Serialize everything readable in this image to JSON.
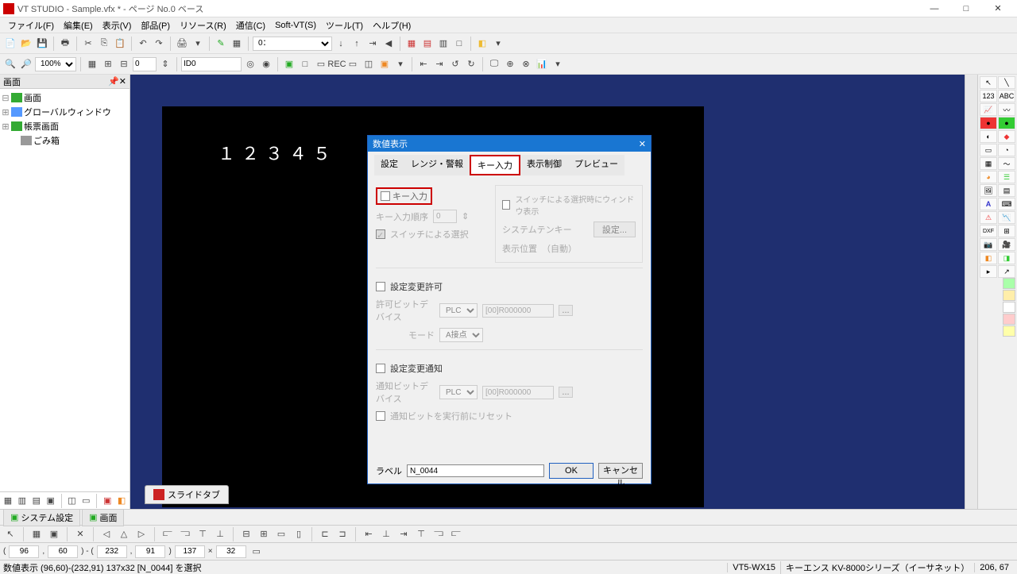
{
  "window": {
    "title": "VT STUDIO - Sample.vfx * - ページ No.0 ベース",
    "min": "—",
    "max": "□",
    "close": "✕"
  },
  "menu": {
    "file": "ファイル(F)",
    "edit": "編集(E)",
    "view": "表示(V)",
    "parts": "部品(P)",
    "resource": "リソース(R)",
    "comm": "通信(C)",
    "softvt": "Soft-VT(S)",
    "tool": "ツール(T)",
    "help": "ヘルプ(H)"
  },
  "toolbar1": {
    "zoom_combo": "0："
  },
  "toolbar2": {
    "zoom_pct": "100%",
    "num_field": "0",
    "id_field": "ID0"
  },
  "sidebar": {
    "header": "画面",
    "items": [
      {
        "exp": "⊟",
        "label": "画面"
      },
      {
        "exp": "⊞",
        "label": "グローバルウィンドウ"
      },
      {
        "exp": "⊞",
        "label": "帳票画面"
      },
      {
        "exp": "",
        "label": "ごみ箱"
      }
    ]
  },
  "bottomtabs": {
    "sys": "システム設定",
    "screen": "画面"
  },
  "canvas": {
    "num_display": "１２３４５",
    "slide_tab": "スライドタブ"
  },
  "coords": {
    "x1": "96",
    "y1": "60",
    "x2": "232",
    "y2": "91",
    "w": "137",
    "h": "32"
  },
  "status": {
    "left": "数値表示 (96,60)-(232,91) 137x32 [N_0044] を選択",
    "model": "VT5-WX15",
    "plc": "キーエンス KV-8000シリーズ（イーサネット）",
    "coord": "206, 67"
  },
  "dialog": {
    "title": "数値表示",
    "tabs": {
      "settei": "設定",
      "range": "レンジ・警報",
      "key": "キー入力",
      "disp": "表示制御",
      "preview": "プレビュー"
    },
    "key_input_chk": "キー入力",
    "order_label": "キー入力順序",
    "order_val": "0",
    "switch_sel": "スイッチによる選択",
    "switch_win": "スイッチによる選択時にウィンドウ表示",
    "sys_tenkey": "システムテンキー",
    "settei_btn": "設定...",
    "disp_pos": "表示位置",
    "disp_pos_val": "（自動）",
    "change_allow": "設定変更許可",
    "allow_dev": "許可ビットデバイス",
    "plc": "PLC",
    "addr": "[00]R000000",
    "mode": "モード",
    "mode_val": "A接点",
    "change_notify": "設定変更通知",
    "notify_dev": "通知ビットデバイス",
    "reset": "通知ビットを実行前にリセット",
    "label_lbl": "ラベル",
    "label_val": "N_0044",
    "ok": "OK",
    "cancel": "キャンセル"
  }
}
